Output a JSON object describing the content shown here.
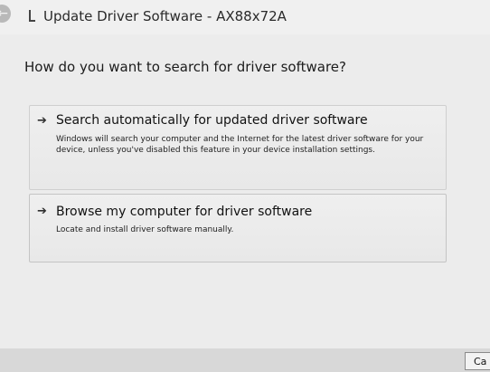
{
  "window": {
    "title": "Update Driver Software - AX88x72A",
    "back_glyph": "←"
  },
  "main": {
    "heading": "How do you want to search for driver software?",
    "options": [
      {
        "title": "Search automatically for updated driver software",
        "description": "Windows will search your computer and the Internet for the latest driver software for your device, unless you've disabled this feature in your device installation settings.",
        "icon": "arrow-right-icon"
      },
      {
        "title": "Browse my computer for driver software",
        "description": "Locate and install driver software manually.",
        "icon": "arrow-right-icon"
      }
    ]
  },
  "footer": {
    "cancel_label": "Ca"
  }
}
